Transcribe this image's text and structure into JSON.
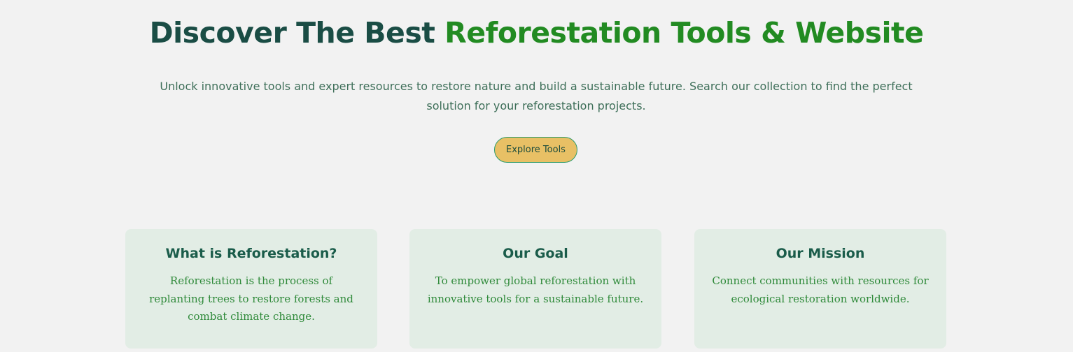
{
  "hero": {
    "title_part1": "Discover The Best ",
    "title_part2": "Reforestation Tools & Website",
    "subtitle": "Unlock innovative tools and expert resources to restore nature and build a sustainable future. Search our collection to find the perfect solution for your reforestation projects.",
    "cta_label": "Explore Tools"
  },
  "cards": [
    {
      "title": "What is Reforestation?",
      "text": "Reforestation is the process of replanting trees to restore forests and combat climate change."
    },
    {
      "title": "Our Goal",
      "text": "To empower global reforestation with innovative tools for a sustainable future."
    },
    {
      "title": "Our Mission",
      "text": "Connect communities with resources for ecological restoration worldwide."
    }
  ],
  "colors": {
    "background": "#f2f2f2",
    "title_dark": "#1a4d45",
    "title_green": "#228b22",
    "button_bg": "#e8c065",
    "card_bg": "#e2ede5"
  }
}
